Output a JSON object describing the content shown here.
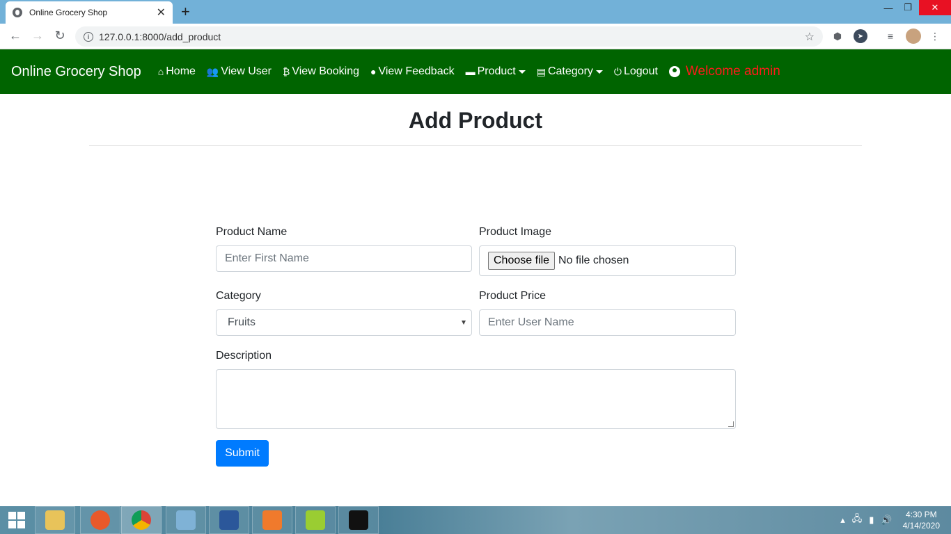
{
  "browser": {
    "tab_title": "Online Grocery Shop",
    "tab_close": "✕",
    "new_tab": "+",
    "url": "127.0.0.1:8000/add_product",
    "minimize": "—",
    "restore": "❐",
    "close": "✕"
  },
  "navbar": {
    "brand": "Online Grocery Shop",
    "links": {
      "home": "Home",
      "view_user": "View User",
      "view_booking": "View Booking",
      "view_feedback": "View Feedback",
      "product": "Product",
      "category": "Category",
      "logout": "Logout"
    },
    "welcome": "Welcome admin",
    "bg_color": "#006400",
    "welcome_color": "#ff1a1a"
  },
  "page": {
    "title": "Add Product"
  },
  "form": {
    "product_name_label": "Product Name",
    "product_name_placeholder": "Enter First Name",
    "product_image_label": "Product Image",
    "choose_file": "Choose file",
    "no_file": "No file chosen",
    "category_label": "Category",
    "category_selected": "Fruits",
    "product_price_label": "Product Price",
    "product_price_placeholder": "Enter User Name",
    "description_label": "Description",
    "submit": "Submit",
    "submit_color": "#007bff"
  },
  "taskbar": {
    "time": "4:30 PM",
    "date": "4/14/2020"
  }
}
